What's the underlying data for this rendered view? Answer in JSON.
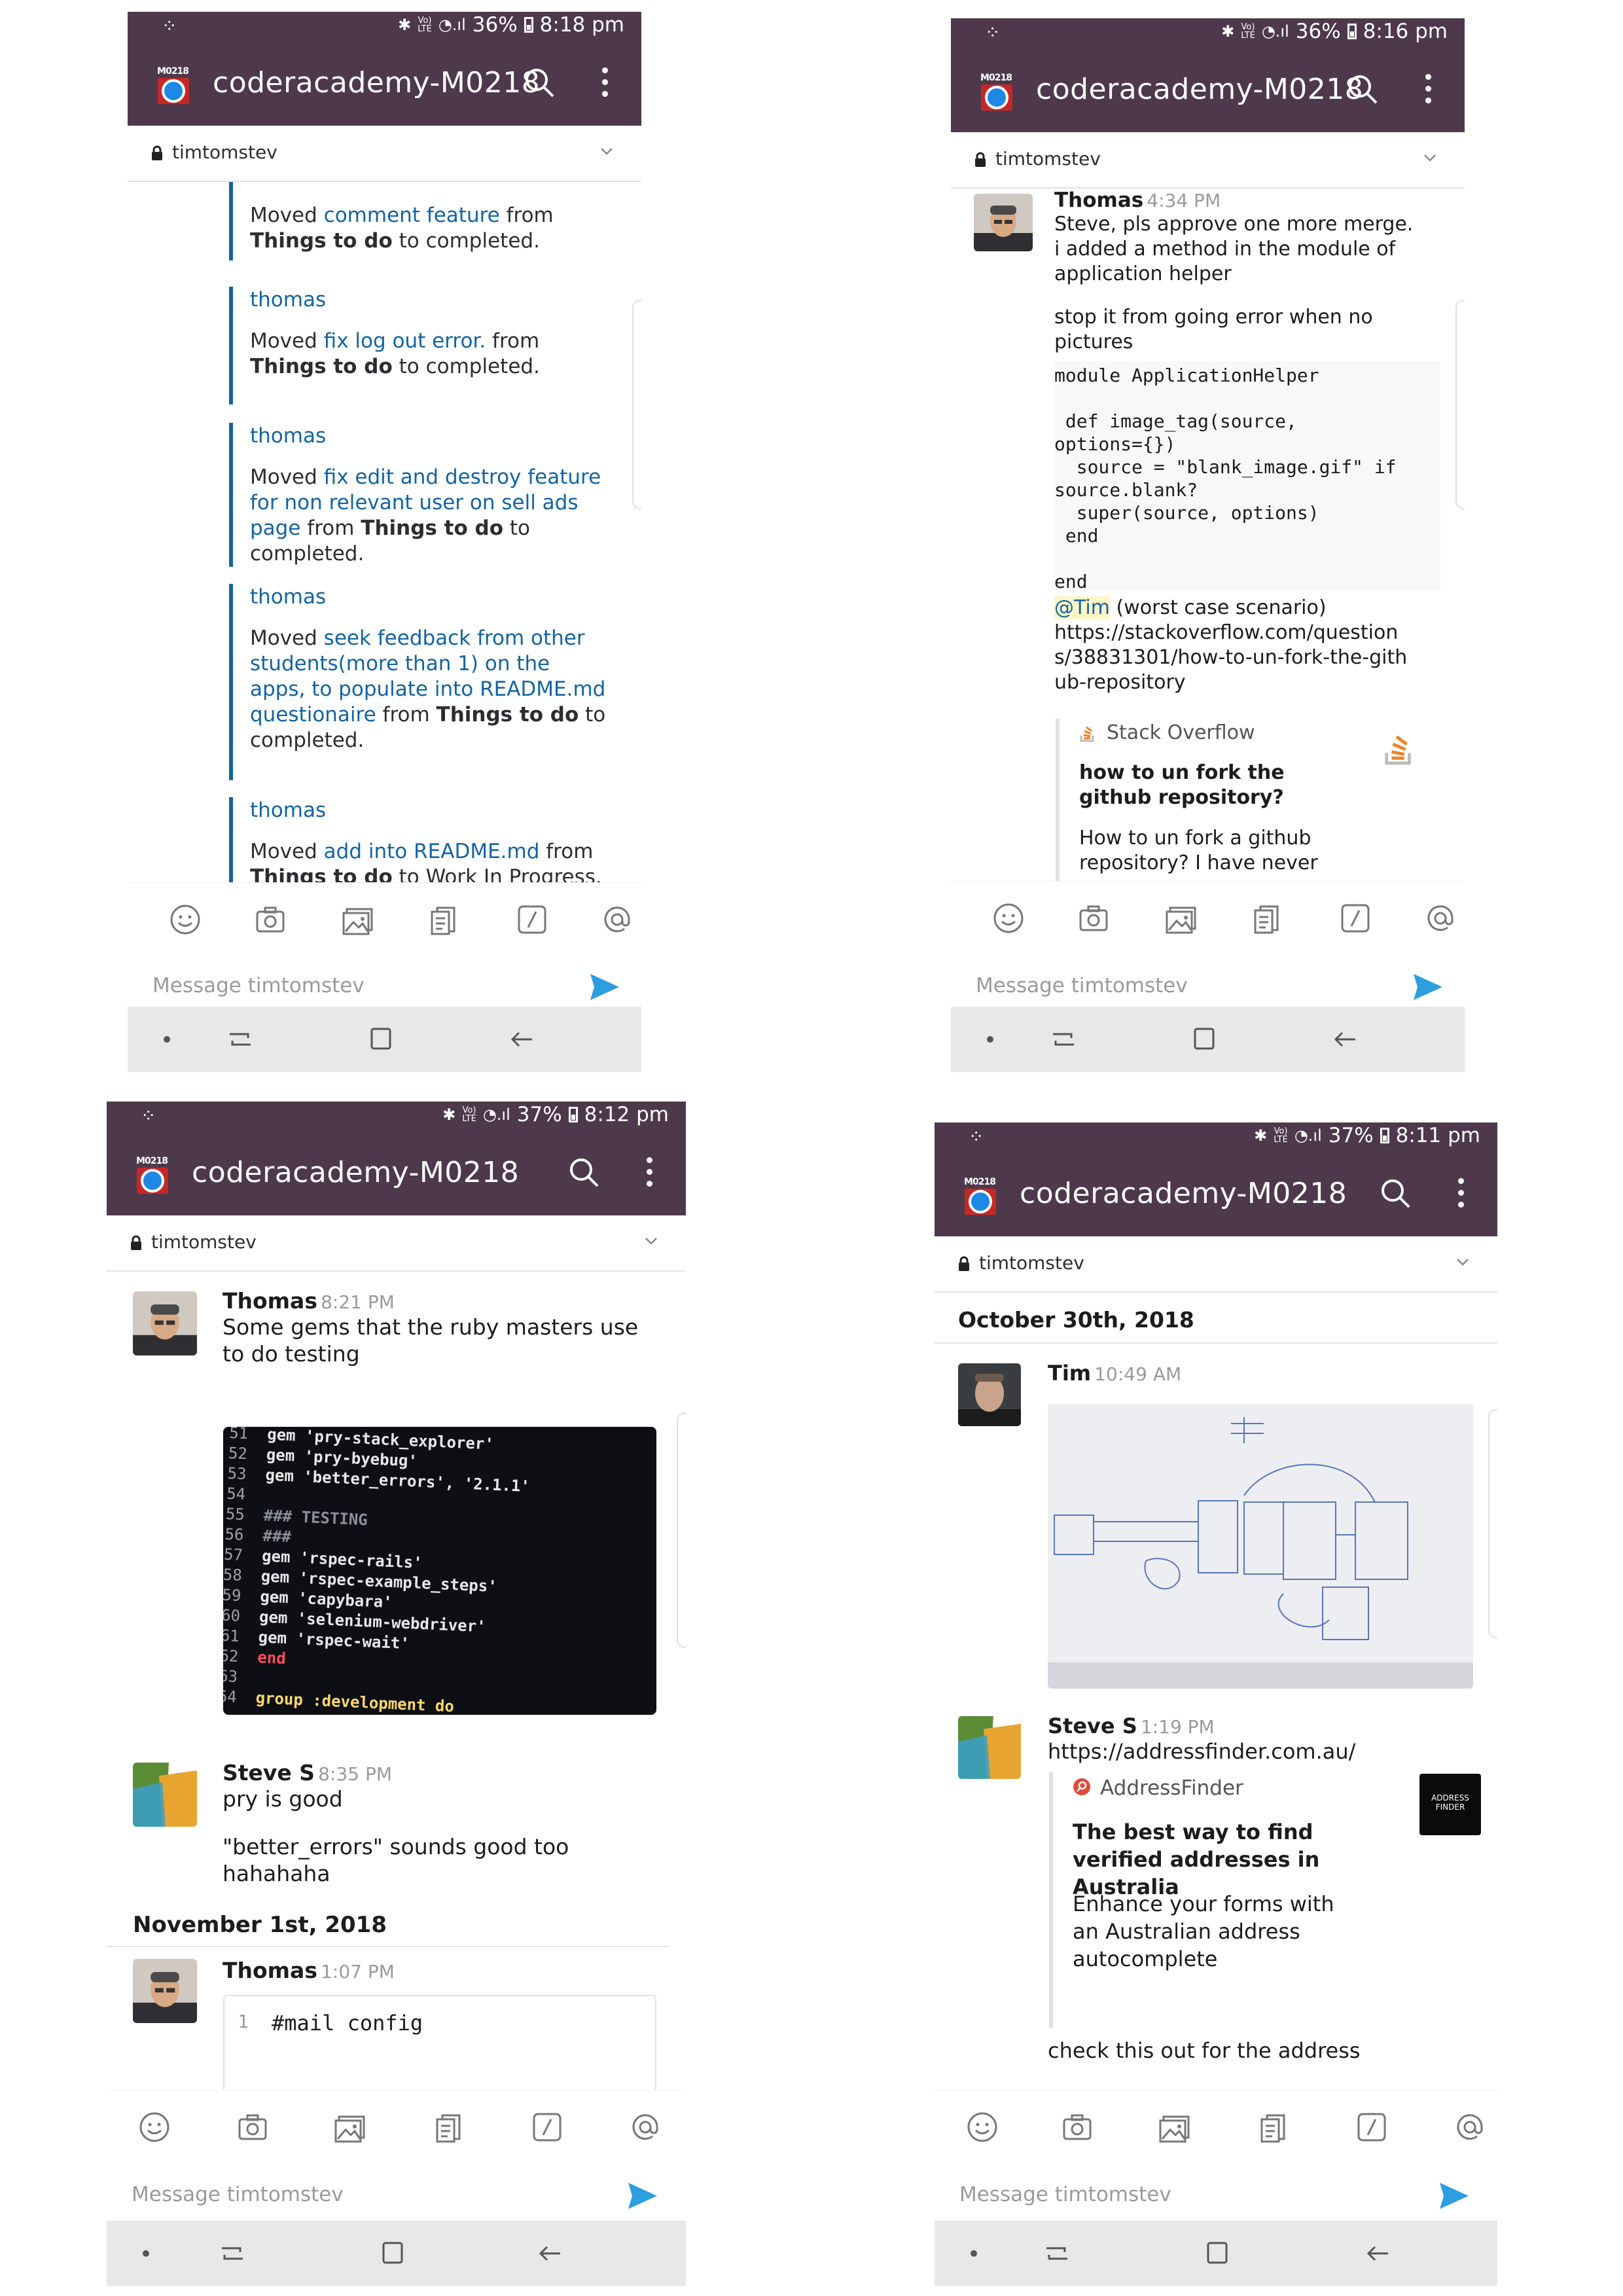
{
  "status": {
    "p1": {
      "battery": "36%",
      "time": "8:18 pm"
    },
    "p2": {
      "battery": "36%",
      "time": "8:16 pm"
    },
    "p3": {
      "battery": "37%",
      "time": "8:12 pm"
    },
    "p4": {
      "battery": "37%",
      "time": "8:11 pm"
    },
    "network": "VoLTE"
  },
  "app": {
    "channel_title": "coderacademy-M0218",
    "logo_label": "M0218",
    "conversation": "timtomstev",
    "message_placeholder": "Message timtomstev"
  },
  "colors": {
    "header": "#4d394b",
    "link": "#1264a3",
    "send": "#2d9ee0"
  },
  "toolbar_icons": [
    "emoji-icon",
    "camera-icon",
    "photo-icon",
    "file-icon",
    "slash-command-icon",
    "mention-icon"
  ],
  "nav_icons": [
    "home-dot-icon",
    "recent-apps-icon",
    "overview-icon",
    "back-icon"
  ],
  "p1": {
    "activities": [
      {
        "who": "",
        "pre": "Moved ",
        "link": "comment feature",
        "mid": " from ",
        "from": "Things to do",
        "post": " to ",
        "to": "completed",
        "end": "."
      },
      {
        "who": "thomas",
        "pre": "Moved ",
        "link": "fix log out error.",
        "mid": " from ",
        "from": "Things to do",
        "post": " to ",
        "to": "completed",
        "end": "."
      },
      {
        "who": "thomas",
        "pre": "Moved ",
        "link": "fix edit and destroy feature for non relevant user on sell ads page",
        "mid": " from ",
        "from": "Things to do",
        "post": " to ",
        "to": "completed",
        "end": "."
      },
      {
        "who": "thomas",
        "pre": "Moved ",
        "link": "seek feedback from other students(more than 1) on the apps, to populate into README.md questionaire",
        "mid": " from ",
        "from": "Things to do",
        "post": " to ",
        "to": "completed",
        "end": "."
      },
      {
        "who": "thomas",
        "pre": "Moved ",
        "link": "add into README.md",
        "mid": " from ",
        "from": "Things to do",
        "post": " to ",
        "to": "Work In Progress",
        "end": "."
      }
    ]
  },
  "p2": {
    "author": "Thomas",
    "time": "4:34 PM",
    "line1": "Steve, pls approve one more merge.",
    "line2": "i added a method in the module of application helper",
    "line3": "stop it from going error when no pictures",
    "code": "module ApplicationHelper\n\n def image_tag(source,\noptions={})\n  source = \"blank_image.gif\" if\nsource.blank?\n  super(source, options)\n end\n\nend",
    "mention": "@Tim",
    "mention_rest": " (worst case scenario)",
    "url": "https://stackoverflow.com/questions/38831301/how-to-un-fork-the-github-repository",
    "unfurl_site": "Stack Overflow",
    "unfurl_title": "how to un fork the github repository?",
    "unfurl_desc": "How to un fork a github repository? I have never seen"
  },
  "p3": {
    "m1_author": "Thomas",
    "m1_time": "8:21 PM",
    "m1_text": "Some gems that the ruby masters use to do testing",
    "code_lines": [
      {
        "n": "51",
        "t": "gem 'pry-stack_explorer'"
      },
      {
        "n": "52",
        "t": "gem 'pry-byebug'"
      },
      {
        "n": "53",
        "t": "gem 'better_errors', '2.1.1'"
      },
      {
        "n": "54",
        "t": ""
      },
      {
        "n": "55",
        "t": "### TESTING"
      },
      {
        "n": "56",
        "t": "###"
      },
      {
        "n": "57",
        "t": "gem 'rspec-rails'"
      },
      {
        "n": "58",
        "t": "gem 'rspec-example_steps'"
      },
      {
        "n": "59",
        "t": "gem 'capybara'"
      },
      {
        "n": "60",
        "t": "gem 'selenium-webdriver'"
      },
      {
        "n": "61",
        "t": "gem 'rspec-wait'"
      },
      {
        "n": "62",
        "t": "end"
      },
      {
        "n": "63",
        "t": ""
      },
      {
        "n": "64",
        "t": "group :development do"
      }
    ],
    "m2_author": "Steve S",
    "m2_time": "8:35 PM",
    "m2_text1": "pry is good",
    "m2_text2": "\"better_errors\" sounds good too hahahaha",
    "date": "November 1st, 2018",
    "m3_author": "Thomas",
    "m3_time": "1:07 PM",
    "m3_code_num": "1",
    "m3_code": "#mail config"
  },
  "p4": {
    "date": "October 30th, 2018",
    "m1_author": "Tim",
    "m1_time": "10:49 AM",
    "m2_author": "Steve S",
    "m2_time": "1:19 PM",
    "url": "https://addressfinder.com.au/",
    "unfurl_site": "AddressFinder",
    "unfurl_title": "The best way to find verified addresses in Australia",
    "unfurl_desc": "Enhance your forms with an Australian address autocomplete",
    "unfurl_logo": "ADDRESS FINDER",
    "text": "check this out for the address"
  }
}
